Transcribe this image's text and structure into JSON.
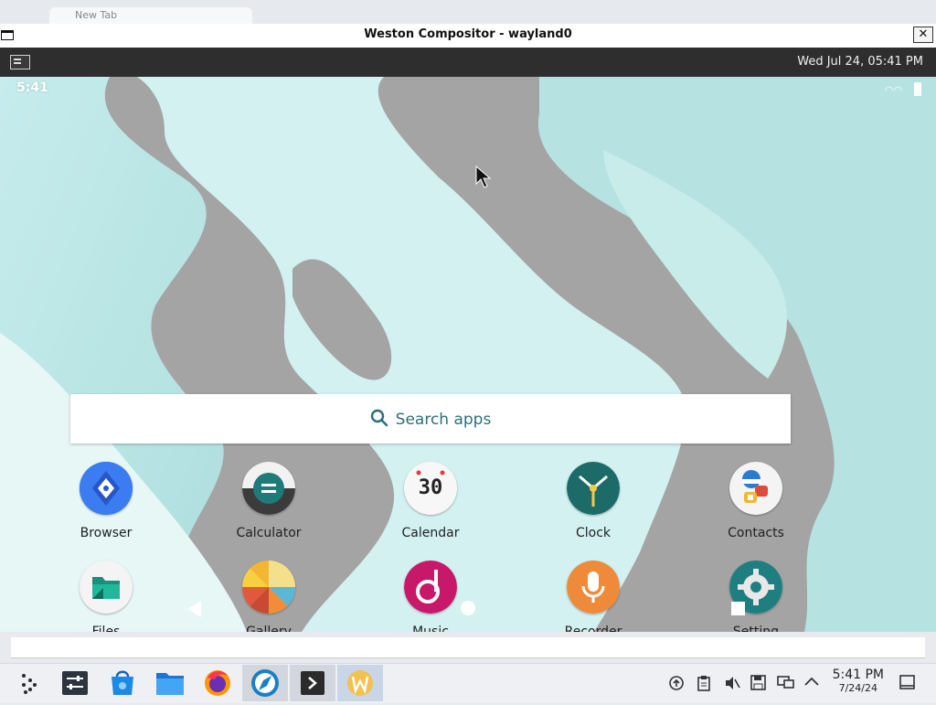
{
  "host": {
    "tab_title": "New Tab"
  },
  "window": {
    "title": "Weston Compositor - wayland0",
    "close_label": "✕"
  },
  "weston_panel": {
    "datetime": "Wed Jul 24, 05:41 PM"
  },
  "android": {
    "status_time": "5:41",
    "search_placeholder": "Search apps",
    "apps": [
      {
        "label": "Browser",
        "icon": "browser-icon"
      },
      {
        "label": "Calculator",
        "icon": "calculator-icon"
      },
      {
        "label": "Calendar",
        "icon": "calendar-icon",
        "badge": "30"
      },
      {
        "label": "Clock",
        "icon": "clock-icon"
      },
      {
        "label": "Contacts",
        "icon": "contacts-icon"
      },
      {
        "label": "Files",
        "icon": "files-icon"
      },
      {
        "label": "Gallery",
        "icon": "gallery-icon"
      },
      {
        "label": "Music",
        "icon": "music-icon"
      },
      {
        "label": "Recorder",
        "icon": "recorder-icon"
      },
      {
        "label": "Setting",
        "icon": "settings-icon"
      }
    ],
    "nav": [
      "back",
      "home",
      "recents"
    ]
  },
  "taskbar": {
    "apps": [
      "start-menu",
      "system-settings",
      "discover-store",
      "file-manager",
      "firefox",
      "browser",
      "terminal",
      "weston-app"
    ],
    "tray_icons": [
      "network-icon",
      "clipboard-icon",
      "volume-muted-icon",
      "save-icon",
      "display-icon",
      "tray-expand-icon"
    ],
    "time": "5:41 PM",
    "date": "7/24/24"
  },
  "colors": {
    "panel_bg": "#2e2e2e",
    "wall_teal": "#bfe6e6",
    "wall_gray": "#a3a3a3",
    "search_text": "#2b6f7a",
    "taskbar_bg": "#eef0f3"
  }
}
